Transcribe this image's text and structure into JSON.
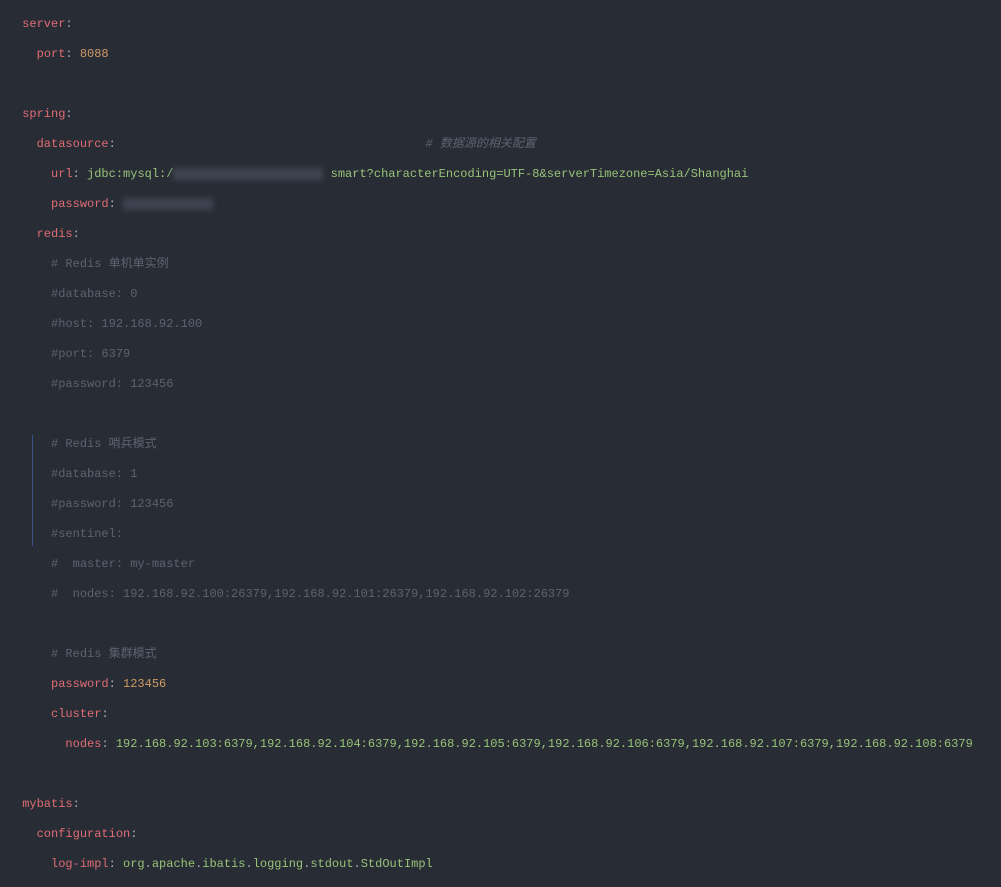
{
  "yaml": {
    "server_key": "server",
    "server_port_key": "port",
    "server_port_val": "8088",
    "spring_key": "spring",
    "ds_key": "datasource",
    "ds_hint": "# 数据源的相关配置",
    "ds_url_key": "url",
    "ds_url_pre": "jdbc:mysql:/",
    "ds_url_post": "smart?characterEncoding=UTF-8&serverTimezone=Asia/Shanghai",
    "ds_pwd_key": "password",
    "redis_key": "redis",
    "c_single_title": "# Redis 单机单实例",
    "c_db0": "#database: 0",
    "c_host": "#host: 192.168.92.100",
    "c_port": "#port: 6379",
    "c_pwd1": "#password: 123456",
    "c_sentinel_title": "# Redis 哨兵模式",
    "c_db1": "#database: 1",
    "c_pwd2": "#password: 123456",
    "c_sent": "#sentinel:",
    "c_master": "#  master: my-master",
    "c_nodes": "#  nodes: 192.168.92.100:26379,192.168.92.101:26379,192.168.92.102:26379",
    "c_cluster_title": "# Redis 集群模式",
    "redis_pwd_key": "password",
    "redis_pwd_val": "123456",
    "cluster_key": "cluster",
    "cluster_nodes_key": "nodes",
    "cluster_nodes_val": "192.168.92.103:6379,192.168.92.104:6379,192.168.92.105:6379,192.168.92.106:6379,192.168.92.107:6379,192.168.92.108:6379",
    "mybatis_key": "mybatis",
    "config_key": "configuration",
    "logimpl_key": "log-impl",
    "logimpl_p1": "org",
    "logimpl_p2": "apache",
    "logimpl_p3": "ibatis",
    "logimpl_p4": "logging",
    "logimpl_p5": "stdout",
    "logimpl_p6": "StdOutImpl"
  }
}
